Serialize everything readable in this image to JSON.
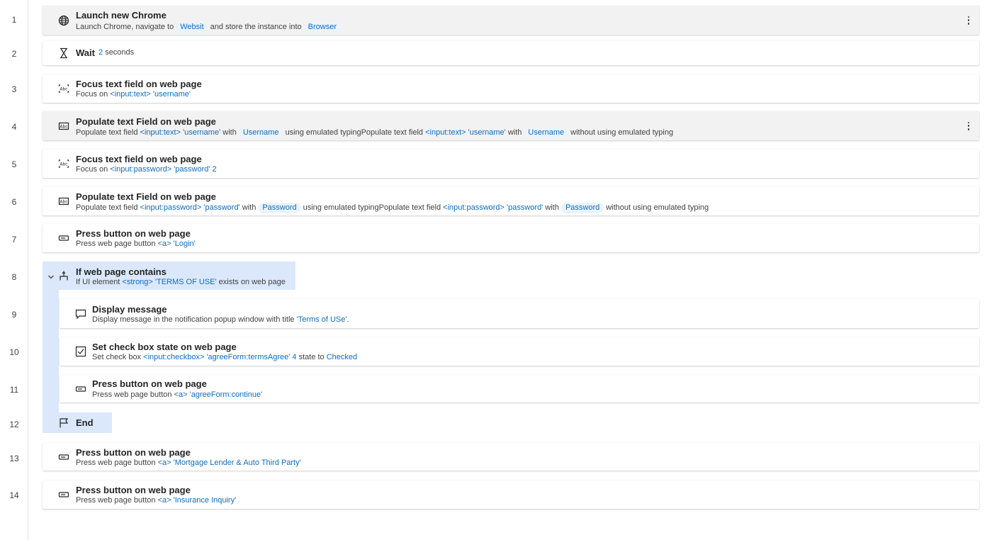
{
  "line_numbers": [
    "1",
    "2",
    "3",
    "4",
    "5",
    "6",
    "7",
    "8",
    "9",
    "10",
    "11",
    "12",
    "13",
    "14"
  ],
  "steps": [
    {
      "icon": "globe-icon",
      "title": "Launch new Chrome",
      "sub": {
        "t1": "Launch Chrome, navigate to",
        "c1": "Websit",
        "t2": "and store the instance into",
        "c2": "Browser"
      }
    },
    {
      "icon": "hourglass-icon",
      "title": "Wait",
      "sub": {
        "num": "2",
        "unit": "seconds"
      }
    },
    {
      "icon": "focus-text-field-icon",
      "title": "Focus text field on web page",
      "sub": {
        "t1": "Focus on",
        "tok": "<input:text> 'username'"
      }
    },
    {
      "icon": "text-field-icon",
      "title": "Populate text Field on web page",
      "sub": {
        "t1": "Populate text field",
        "tok1": "<input:text> 'username'",
        "t2": "with",
        "c1": "Username",
        "t3": "using emulated typingPopulate text field",
        "tok2": "<input:text> 'username'",
        "t4": "with",
        "c2": "Username",
        "t5": "without using emulated typing"
      }
    },
    {
      "icon": "focus-text-field-icon",
      "title": "Focus text field on web page",
      "sub": {
        "t1": "Focus on",
        "tok": "<input:password> 'password' 2"
      }
    },
    {
      "icon": "text-field-icon",
      "title": "Populate text Field on web page",
      "sub": {
        "t1": "Populate text field",
        "tok1": "<input:password> 'password'",
        "t2": "with",
        "c1": "Password",
        "t3": "using emulated typingPopulate text field",
        "tok2": "<input:password> 'password'",
        "t4": "with",
        "c2": "Password",
        "t5": "without using emulated typing"
      }
    },
    {
      "icon": "button-icon",
      "title": "Press button on web page",
      "sub": {
        "t1": "Press web page button",
        "tok": "<a> 'Login'"
      }
    },
    {
      "icon": "branch-icon",
      "title": "If web page contains",
      "sub": {
        "t1": "If UI element",
        "tok": "<strong> 'TERMS OF USE'",
        "t2": "exists on web page"
      }
    },
    {
      "icon": "message-icon",
      "title": "Display message",
      "sub": {
        "t1": "Display message  in the notification popup window with title",
        "tok": "'Terms of USe'",
        "t2": "."
      }
    },
    {
      "icon": "checkbox-icon",
      "title": "Set check box state on web page",
      "sub": {
        "t1": "Set check box",
        "tok": "<input:checkbox> 'agreeForm:termsAgree' 4",
        "t2": "state to",
        "tok2": "Checked"
      }
    },
    {
      "icon": "button-icon",
      "title": "Press button on web page",
      "sub": {
        "t1": "Press web page button",
        "tok": "<a> 'agreeForm:continue'"
      }
    },
    {
      "icon": "flag-icon",
      "title": "End"
    },
    {
      "icon": "button-icon",
      "title": "Press button on web page",
      "sub": {
        "t1": "Press web page button",
        "tok": "<a> 'Mortgage Lender & Auto Third Party'"
      }
    },
    {
      "icon": "button-icon",
      "title": "Press button on web page",
      "sub": {
        "t1": "Press web page button",
        "tok": "<a> 'Insurance Inquiry'"
      }
    }
  ]
}
